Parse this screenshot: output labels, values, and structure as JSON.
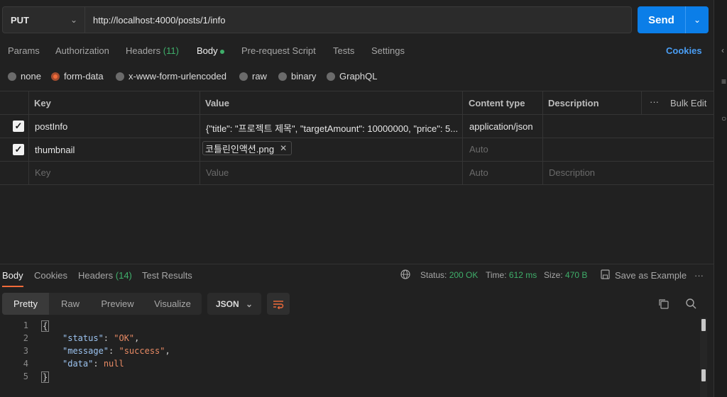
{
  "request": {
    "method": "PUT",
    "url": "http://localhost:4000/posts/1/info",
    "send_label": "Send"
  },
  "request_tabs": {
    "params": "Params",
    "authorization": "Authorization",
    "headers": "Headers",
    "headers_count": "(11)",
    "body": "Body",
    "pre_request": "Pre-request Script",
    "tests": "Tests",
    "settings": "Settings",
    "cookies": "Cookies"
  },
  "body_types": {
    "none": "none",
    "form_data": "form-data",
    "urlencoded": "x-www-form-urlencoded",
    "raw": "raw",
    "binary": "binary",
    "graphql": "GraphQL"
  },
  "form_table": {
    "headers": {
      "key": "Key",
      "value": "Value",
      "content_type": "Content type",
      "description": "Description",
      "bulk_edit": "Bulk Edit"
    },
    "rows": [
      {
        "key": "postInfo",
        "value": "{\"title\": \"프로젝트 제목\", \"targetAmount\": 10000000, \"price\": 5...",
        "content_type": "application/json"
      },
      {
        "key": "thumbnail",
        "file": "코틀린인액션.png",
        "content_type_placeholder": "Auto"
      }
    ],
    "placeholder_row": {
      "key": "Key",
      "value": "Value",
      "content_type": "Auto",
      "description": "Description"
    }
  },
  "response_tabs": {
    "body": "Body",
    "cookies": "Cookies",
    "headers": "Headers",
    "headers_count": "(14)",
    "test_results": "Test Results"
  },
  "response_meta": {
    "status_label": "Status:",
    "status_value": "200 OK",
    "time_label": "Time:",
    "time_value": "612 ms",
    "size_label": "Size:",
    "size_value": "470 B",
    "save_example": "Save as Example"
  },
  "view_modes": {
    "pretty": "Pretty",
    "raw": "Raw",
    "preview": "Preview",
    "visualize": "Visualize",
    "format": "JSON"
  },
  "response_body": {
    "line_numbers": [
      "1",
      "2",
      "3",
      "4",
      "5"
    ],
    "open_brace": "{",
    "close_brace": "}",
    "status_key": "\"status\"",
    "status_val": "\"OK\"",
    "message_key": "\"message\"",
    "message_val": "\"success\"",
    "data_key": "\"data\"",
    "data_val": "null"
  },
  "colors": {
    "accent": "#f26b3a",
    "send": "#0b7ee8",
    "success": "#3fae6a",
    "link": "#4a9ef5"
  }
}
